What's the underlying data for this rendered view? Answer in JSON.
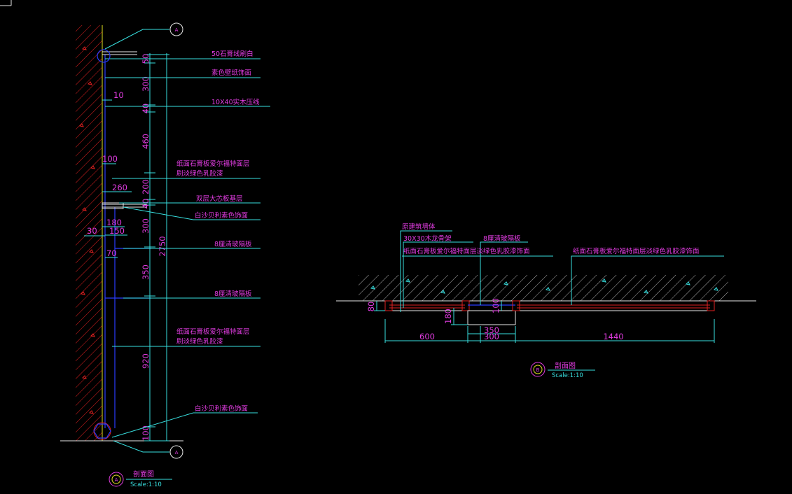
{
  "section_a": {
    "marker_letter": "A",
    "title": "剖面图",
    "scale": "Scale:1:10",
    "labels": [
      "50石膏线刷白",
      "素色壁纸饰面",
      "10X40实木压线",
      "纸面石膏板爱尔福特面层",
      "刷淡绿色乳胶漆",
      "双层大芯板基层",
      "白沙贝利素色饰面",
      "8厘清玻隔板",
      "8厘清玻隔板",
      "纸面石膏板爱尔福特面层",
      "刷淡绿色乳胶漆",
      "白沙贝利素色饰面"
    ],
    "vertical_dims": [
      "50",
      "300",
      "40",
      "460",
      "200",
      "40",
      "300",
      "350",
      "920",
      "100"
    ],
    "total_height": "2750",
    "horizontal_dims": [
      "10",
      "100",
      "260",
      "180",
      "150",
      "30",
      "70"
    ]
  },
  "section_b": {
    "marker_letter": "B",
    "title": "剖面图",
    "scale": "Scale:1:10",
    "labels": [
      "原建筑墙体",
      "30X30木龙骨架",
      "纸面石膏板爱尔福特面层淡绿色乳胶漆饰面",
      "8厘清玻隔板",
      "纸面石膏板爱尔福特面层淡绿色乳胶漆饰面"
    ],
    "dims": [
      "80",
      "180",
      "100",
      "350",
      "600",
      "300",
      "1440"
    ]
  },
  "colors": {
    "background": "#000000",
    "text": "#e03ce0",
    "leader": "#38e0e0",
    "wall_hatch": "#e02020",
    "floor_hatch": "#ffffff",
    "glass": "#2a3cff"
  }
}
